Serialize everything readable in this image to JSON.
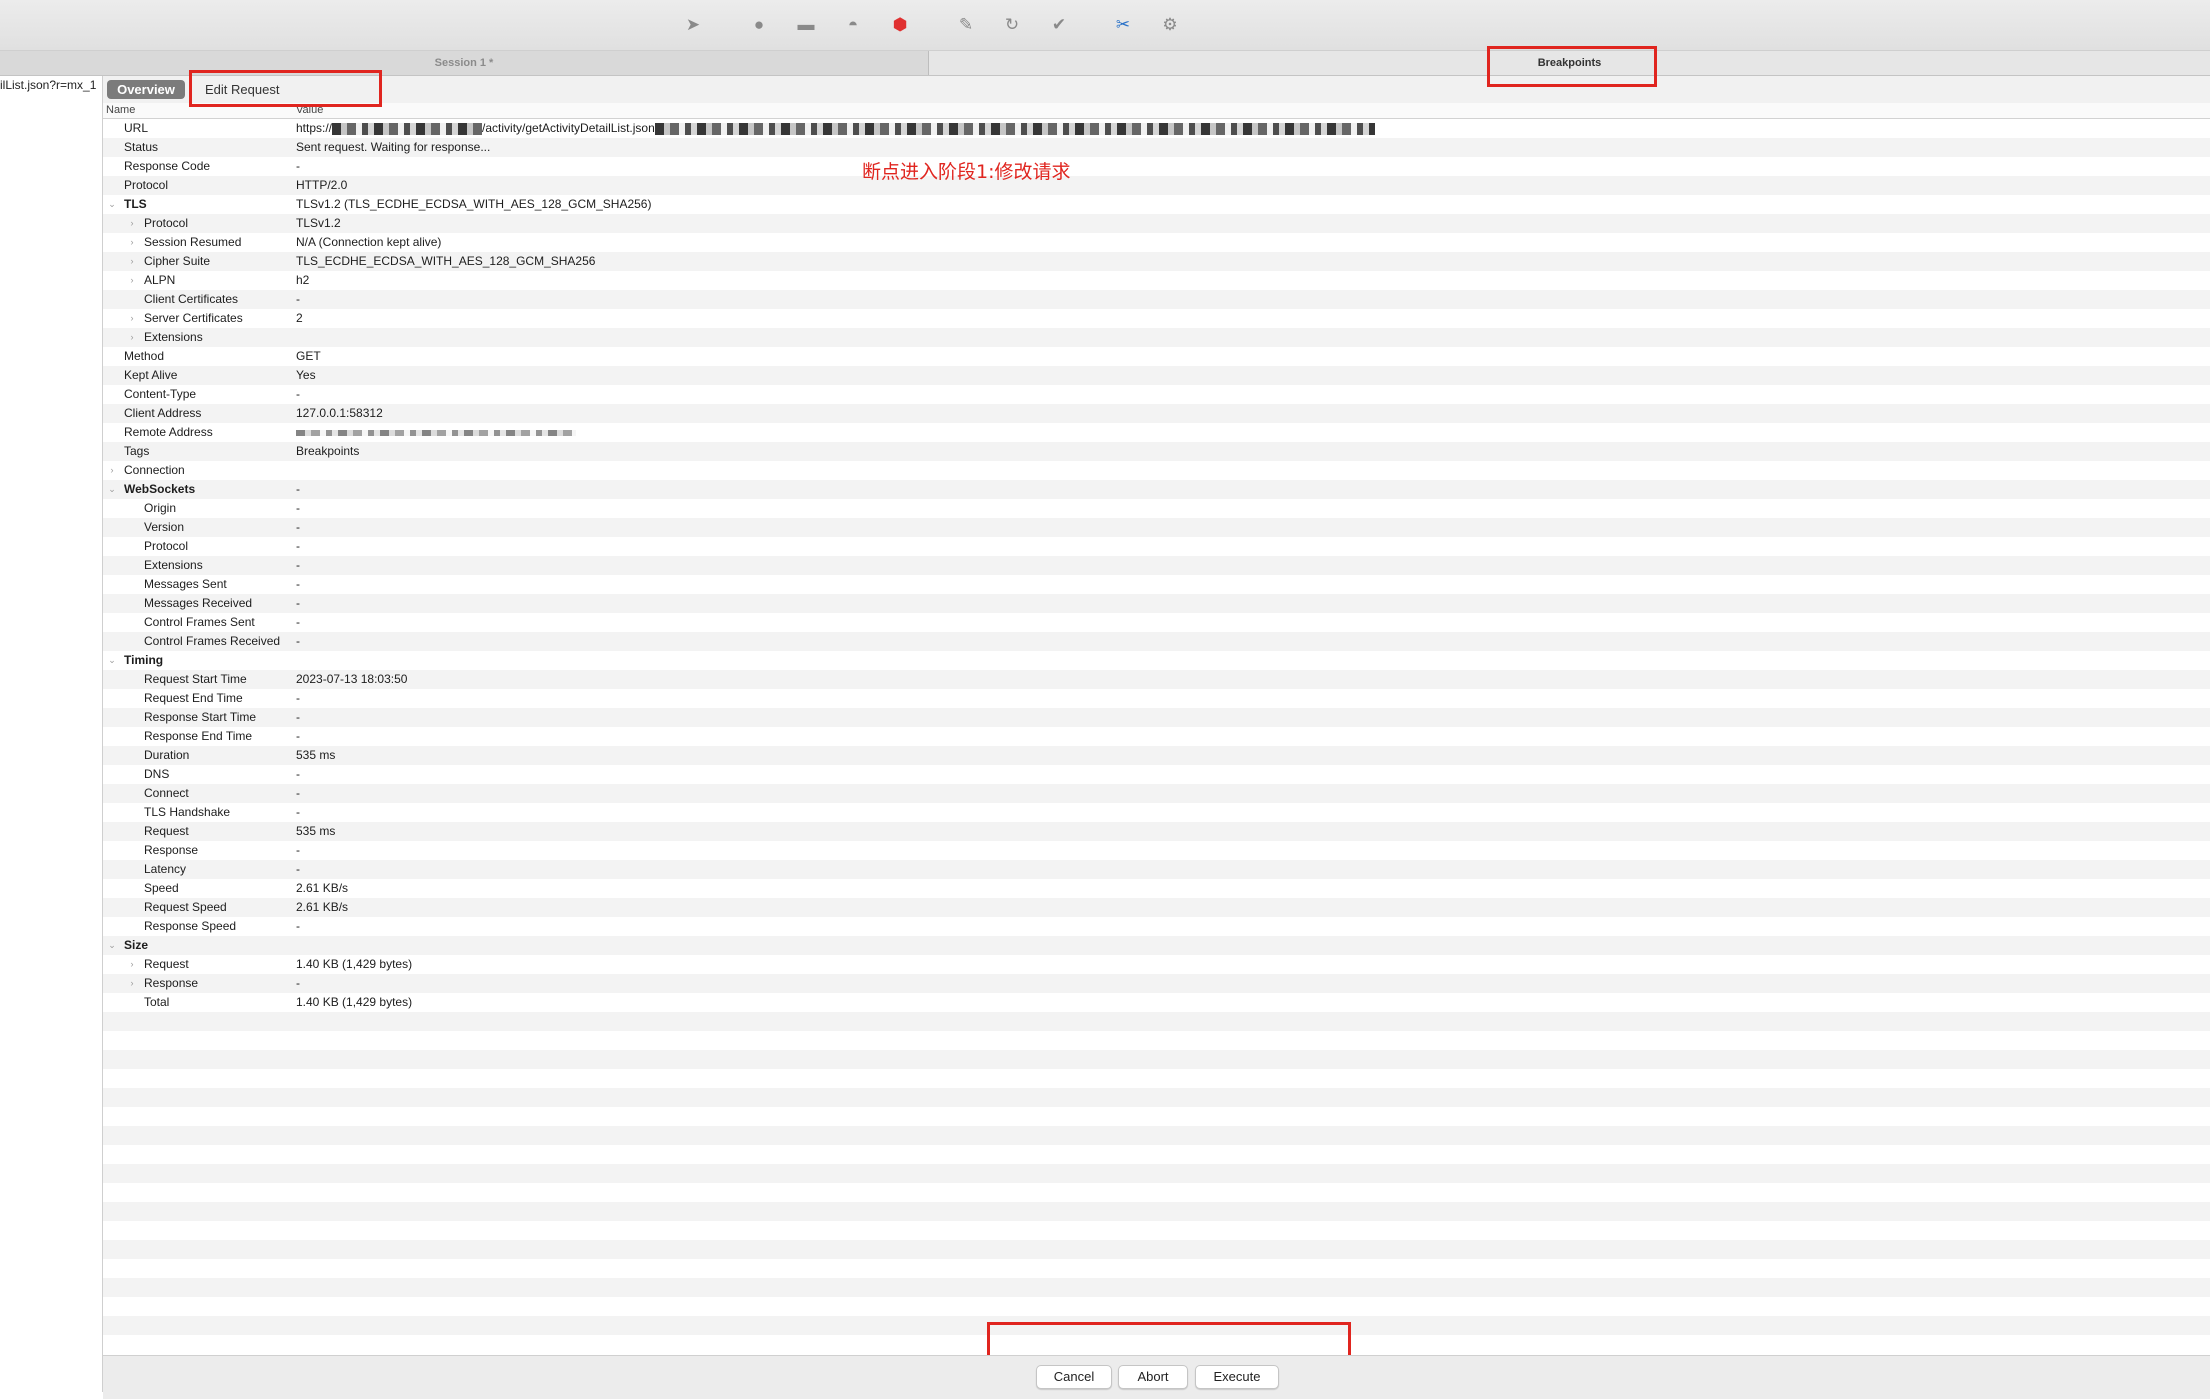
{
  "toolbar": {
    "icons": [
      "cursor-icon",
      "record-icon",
      "broom-icon",
      "turtle-icon",
      "breakpoint-icon",
      "pen-icon",
      "refresh-icon",
      "checkmark-icon",
      "tools-icon",
      "settings-icon"
    ]
  },
  "session_tabs": {
    "session": "Session 1 *",
    "breakpoints": "Breakpoints"
  },
  "left_panel": {
    "item": "ilList.json?r=mx_1"
  },
  "subtabs": {
    "overview": "Overview",
    "edit_request": "Edit Request"
  },
  "table": {
    "headers": {
      "name": "Name",
      "value": "Value"
    },
    "rows": [
      {
        "name": "URL",
        "value": "https://",
        "value2": "/activity/getActivityDetailList.json",
        "level": 0,
        "kind": "url"
      },
      {
        "name": "Status",
        "value": "Sent request. Waiting for response...",
        "level": 0
      },
      {
        "name": "Response Code",
        "value": "-",
        "level": 0
      },
      {
        "name": "Protocol",
        "value": "HTTP/2.0",
        "level": 0
      },
      {
        "name": "TLS",
        "value": "TLSv1.2 (TLS_ECDHE_ECDSA_WITH_AES_128_GCM_SHA256)",
        "level": 0,
        "bold": true,
        "expand": "open"
      },
      {
        "name": "Protocol",
        "value": "TLSv1.2",
        "level": 1,
        "expand": "closed"
      },
      {
        "name": "Session Resumed",
        "value": "N/A (Connection kept alive)",
        "level": 1,
        "expand": "closed"
      },
      {
        "name": "Cipher Suite",
        "value": "TLS_ECDHE_ECDSA_WITH_AES_128_GCM_SHA256",
        "level": 1,
        "expand": "closed"
      },
      {
        "name": "ALPN",
        "value": "h2",
        "level": 1,
        "expand": "closed"
      },
      {
        "name": "Client Certificates",
        "value": "-",
        "level": 1
      },
      {
        "name": "Server Certificates",
        "value": "2",
        "level": 1,
        "expand": "closed"
      },
      {
        "name": "Extensions",
        "value": "",
        "level": 1,
        "expand": "closed"
      },
      {
        "name": "Method",
        "value": "GET",
        "level": 0
      },
      {
        "name": "Kept Alive",
        "value": "Yes",
        "level": 0
      },
      {
        "name": "Content-Type",
        "value": "-",
        "level": 0
      },
      {
        "name": "Client Address",
        "value": "127.0.0.1:58312",
        "level": 0
      },
      {
        "name": "Remote Address",
        "value": "",
        "level": 0,
        "kind": "blur"
      },
      {
        "name": "Tags",
        "value": "Breakpoints",
        "level": 0
      },
      {
        "name": "Connection",
        "value": "",
        "level": 0,
        "expand": "closed"
      },
      {
        "name": "WebSockets",
        "value": "-",
        "level": 0,
        "bold": true,
        "expand": "open"
      },
      {
        "name": "Origin",
        "value": "-",
        "level": 1
      },
      {
        "name": "Version",
        "value": "-",
        "level": 1
      },
      {
        "name": "Protocol",
        "value": "-",
        "level": 1
      },
      {
        "name": "Extensions",
        "value": "-",
        "level": 1
      },
      {
        "name": "Messages Sent",
        "value": "-",
        "level": 1
      },
      {
        "name": "Messages Received",
        "value": "-",
        "level": 1
      },
      {
        "name": "Control Frames Sent",
        "value": "-",
        "level": 1
      },
      {
        "name": "Control Frames Received",
        "value": "-",
        "level": 1
      },
      {
        "name": "Timing",
        "value": "",
        "level": 0,
        "bold": true,
        "expand": "open"
      },
      {
        "name": "Request Start Time",
        "value": "2023-07-13 18:03:50",
        "level": 1
      },
      {
        "name": "Request End Time",
        "value": "-",
        "level": 1
      },
      {
        "name": "Response Start Time",
        "value": "-",
        "level": 1
      },
      {
        "name": "Response End Time",
        "value": "-",
        "level": 1
      },
      {
        "name": "Duration",
        "value": "535 ms",
        "level": 1
      },
      {
        "name": "DNS",
        "value": "-",
        "level": 1
      },
      {
        "name": "Connect",
        "value": "-",
        "level": 1
      },
      {
        "name": "TLS Handshake",
        "value": "-",
        "level": 1
      },
      {
        "name": "Request",
        "value": "535 ms",
        "level": 1
      },
      {
        "name": "Response",
        "value": "-",
        "level": 1
      },
      {
        "name": "Latency",
        "value": "-",
        "level": 1
      },
      {
        "name": "Speed",
        "value": "2.61 KB/s",
        "level": 1
      },
      {
        "name": "Request Speed",
        "value": "2.61 KB/s",
        "level": 1
      },
      {
        "name": "Response Speed",
        "value": "-",
        "level": 1
      },
      {
        "name": "Size",
        "value": "",
        "level": 0,
        "bold": true,
        "expand": "open"
      },
      {
        "name": "Request",
        "value": "1.40 KB (1,429 bytes)",
        "level": 1,
        "expand": "closed"
      },
      {
        "name": "Response",
        "value": "-",
        "level": 1,
        "expand": "closed"
      },
      {
        "name": "Total",
        "value": "1.40 KB (1,429 bytes)",
        "level": 1
      }
    ]
  },
  "annotation": {
    "text": "断点进入阶段1:修改请求",
    "color": "#e0251f"
  },
  "buttons": {
    "cancel": "Cancel",
    "abort": "Abort",
    "execute": "Execute"
  }
}
